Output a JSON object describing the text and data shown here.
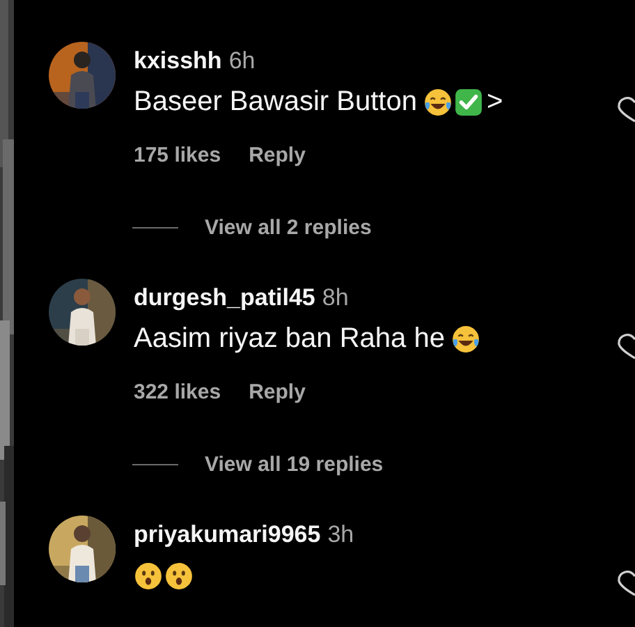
{
  "comments": [
    {
      "avatar": {
        "kind": "picture"
      },
      "username": "kxisshh",
      "time": "6h",
      "body": [
        {
          "kind": "text",
          "text": "Baseer Bawasir Button"
        },
        {
          "kind": "laughing-emoji"
        },
        {
          "kind": "check-emoji"
        },
        {
          "kind": "text",
          "text": ">"
        }
      ],
      "liked": false,
      "likes": "175 likes",
      "reply": "Reply",
      "view_replies": "View all 2 replies"
    },
    {
      "avatar": {
        "kind": "picture"
      },
      "username": "durgesh_patil45",
      "time": "8h",
      "body": [
        {
          "kind": "text",
          "text": "Aasim riyaz ban Raha he"
        },
        {
          "kind": "laughing-emoji"
        }
      ],
      "liked": false,
      "likes": "322 likes",
      "reply": "Reply",
      "view_replies": "View all 19 replies"
    },
    {
      "avatar": {
        "kind": "picture"
      },
      "username": "priyakumari9965",
      "time": "3h",
      "body": [
        {
          "kind": "surprised-emoji"
        },
        {
          "kind": "surprised-emoji"
        }
      ],
      "liked": false
    }
  ]
}
